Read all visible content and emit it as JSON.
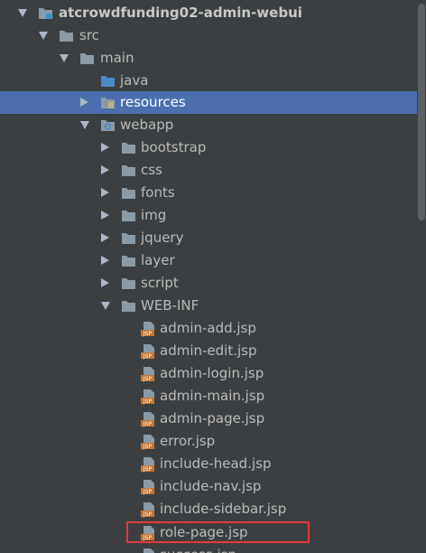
{
  "tree": {
    "project": "atcrowdfunding02-admin-webui",
    "src": "src",
    "main": "main",
    "java": "java",
    "resources": "resources",
    "webapp": "webapp",
    "webapp_folders": [
      "bootstrap",
      "css",
      "fonts",
      "img",
      "jquery",
      "layer",
      "script"
    ],
    "webinf": "WEB-INF",
    "jsp_files": [
      "admin-add.jsp",
      "admin-edit.jsp",
      "admin-login.jsp",
      "admin-main.jsp",
      "admin-page.jsp",
      "error.jsp",
      "include-head.jsp",
      "include-nav.jsp",
      "include-sidebar.jsp",
      "role-page.jsp",
      "success.jsp"
    ],
    "jsp_badge": "JSP",
    "selected_item": "resources",
    "highlighted_item": "role-page.jsp"
  },
  "colors": {
    "background": "#3c3f41",
    "selection": "#4b6eaf",
    "folder": "#8a9aa6",
    "source_folder": "#4a88c7",
    "jsp_icon": "#c57633",
    "highlight_border": "#e03a3a"
  },
  "icons": {
    "module": "module-folder-icon",
    "folder": "folder-icon",
    "source_folder": "source-folder-icon",
    "resources_folder": "resources-folder-icon",
    "web_folder": "web-folder-icon",
    "jsp": "jsp-file-icon"
  }
}
